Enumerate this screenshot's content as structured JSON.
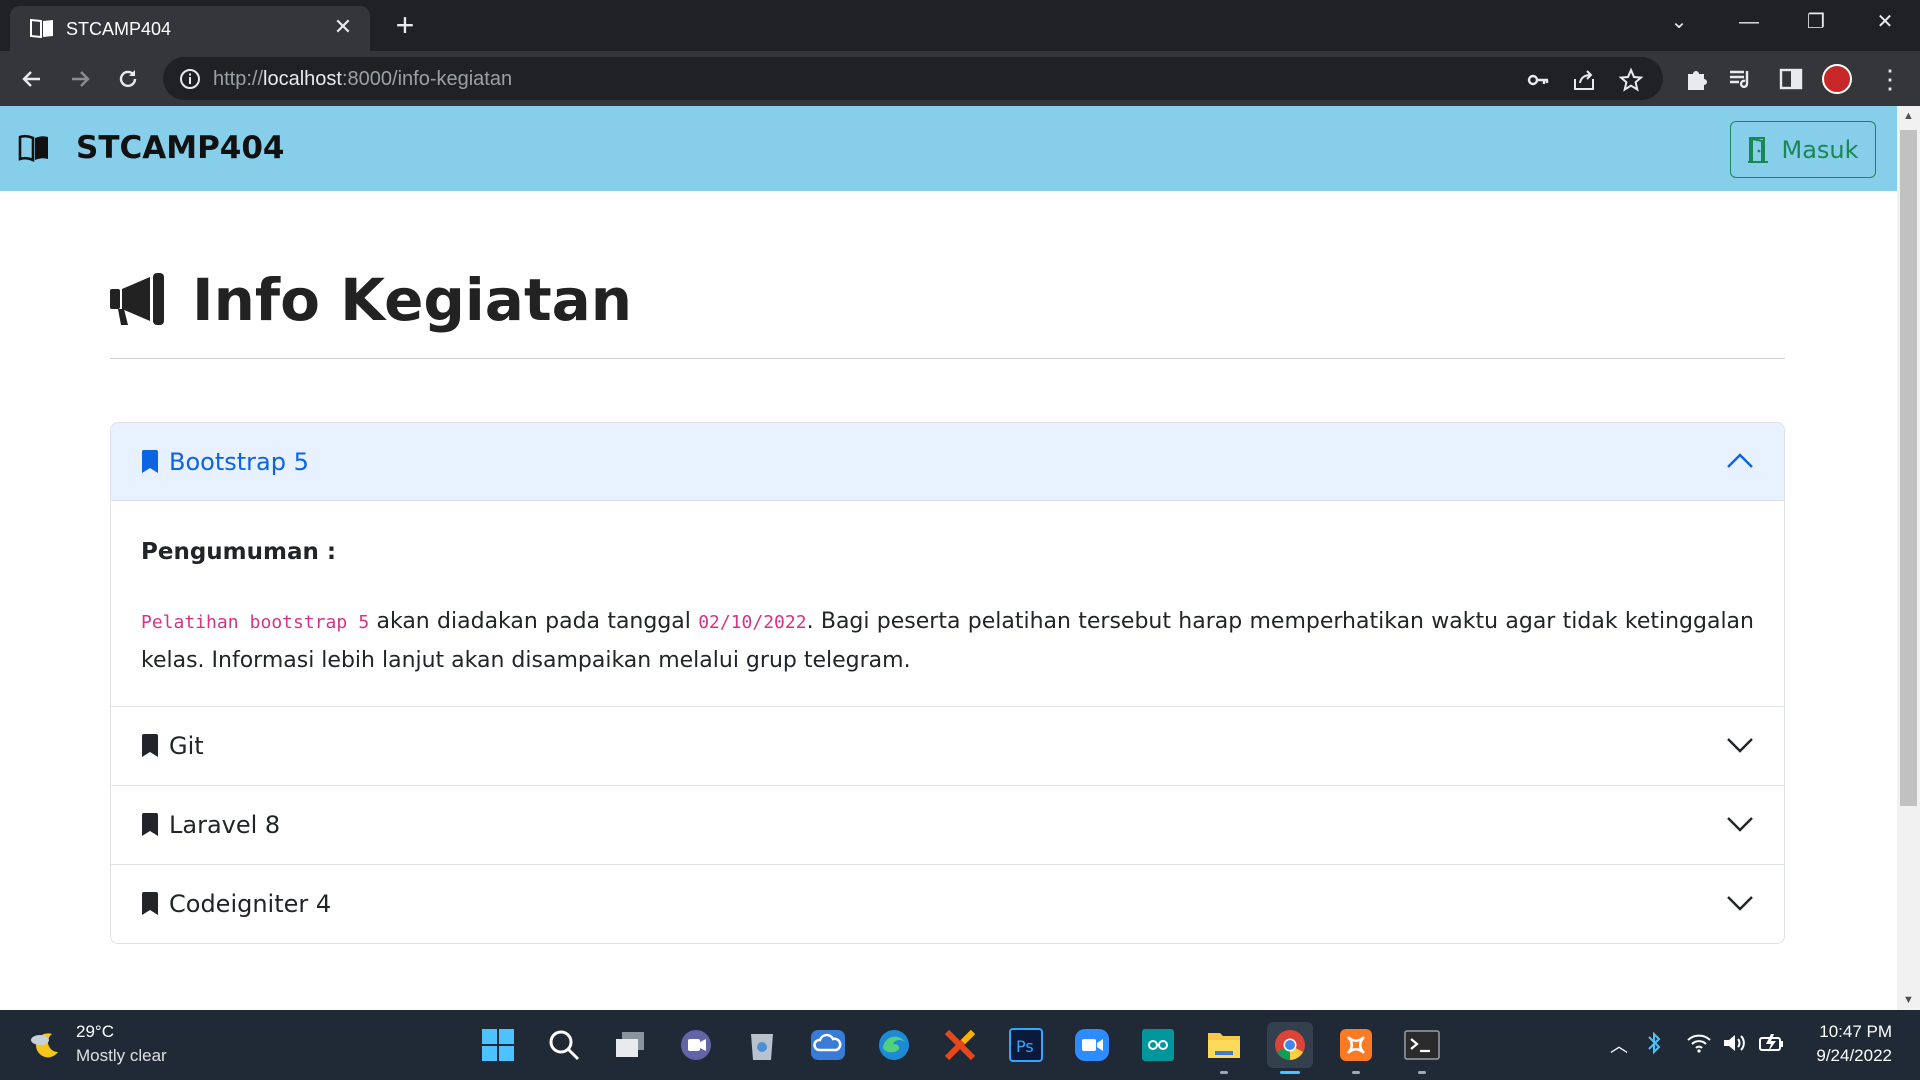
{
  "browser": {
    "tab_title": "STCAMP404",
    "url_prefix": "http://",
    "url_host": "localhost",
    "url_rest": ":8000/info-kegiatan"
  },
  "site": {
    "brand": "STCAMP404",
    "login_label": "Masuk",
    "nav_color": "#87ceeb",
    "login_color": "#198754"
  },
  "page": {
    "title": "Info Kegiatan",
    "accordion": [
      {
        "title": "Bootstrap 5",
        "expanded": true,
        "body_label": "Pengumuman :",
        "body_code_1": "Pelatihan bootstrap 5",
        "body_text_1": " akan diadakan pada tanggal ",
        "body_code_2": "02/10/2022",
        "body_text_2": ". Bagi peserta pelatihan tersebut harap memperhatikan waktu agar tidak ketinggalan kelas. Informasi lebih lanjut akan disampaikan melalui grup telegram."
      },
      {
        "title": "Git",
        "expanded": false
      },
      {
        "title": "Laravel 8",
        "expanded": false
      },
      {
        "title": "Codeigniter 4",
        "expanded": false
      }
    ]
  },
  "taskbar": {
    "weather_temp": "29°C",
    "weather_desc": "Mostly clear",
    "time": "10:47 PM",
    "date": "9/24/2022",
    "apps": [
      "windows-start-icon",
      "search-icon",
      "task-view-icon",
      "teams-chat-icon",
      "recycle-icon",
      "cloud-app-icon",
      "edge-icon",
      "xampp-x-icon",
      "photoshop-icon",
      "zoom-icon",
      "arduino-icon",
      "file-explorer-icon",
      "chrome-icon",
      "xampp-control-icon",
      "terminal-icon"
    ]
  }
}
